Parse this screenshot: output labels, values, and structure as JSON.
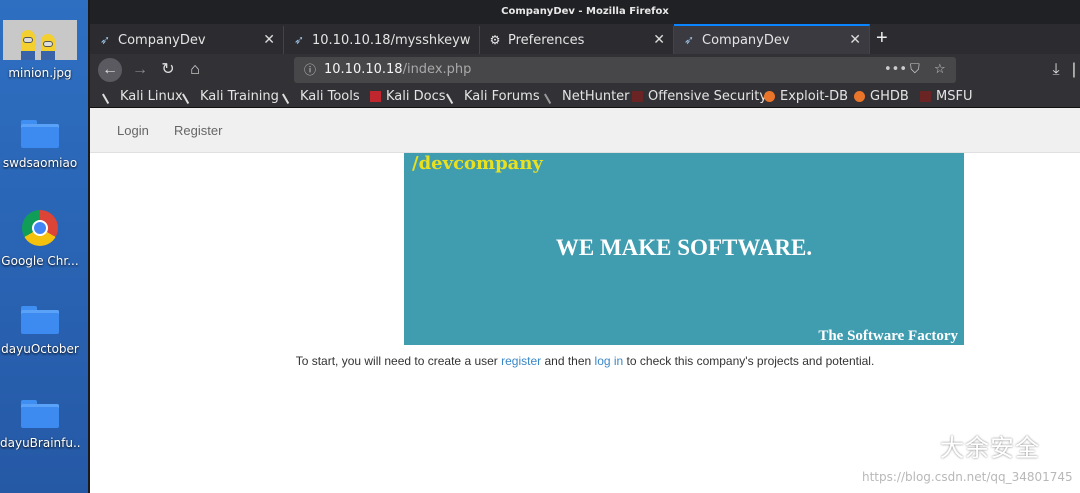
{
  "desktop": {
    "items": [
      {
        "label": "minion.jpg"
      },
      {
        "label": "swdsaomiao"
      },
      {
        "label": "Google Chr..."
      },
      {
        "label": "dayuOctober"
      },
      {
        "label": "dayuBrainfu..."
      }
    ]
  },
  "window": {
    "title": "CompanyDev - Mozilla Firefox"
  },
  "tabs": [
    {
      "label": "CompanyDev",
      "active": false
    },
    {
      "label": "10.10.10.18/mysshkeyw",
      "active": false
    },
    {
      "label": "Preferences",
      "active": false
    },
    {
      "label": "CompanyDev",
      "active": true
    }
  ],
  "urlbar": {
    "host": "10.10.10.18",
    "path": "/index.php"
  },
  "bookmarks": [
    {
      "label": "Kali Linux"
    },
    {
      "label": "Kali Training"
    },
    {
      "label": "Kali Tools"
    },
    {
      "label": "Kali Docs"
    },
    {
      "label": "Kali Forums"
    },
    {
      "label": "NetHunter"
    },
    {
      "label": "Offensive Security"
    },
    {
      "label": "Exploit-DB"
    },
    {
      "label": "GHDB"
    },
    {
      "label": "MSFU"
    }
  ],
  "site": {
    "nav": {
      "login": "Login",
      "register": "Register"
    },
    "banner": {
      "brand": "/devcompany",
      "headline": "WE MAKE SOFTWARE.",
      "tagline": "The Software Factory"
    },
    "intro": {
      "part1": "To start, you will need to create a user ",
      "link1": "register",
      "part2": " and then ",
      "link2": "log in",
      "part3": " to check this company's projects and potential."
    }
  },
  "watermark": {
    "title": "大余安全",
    "url": "https://blog.csdn.net/qq_34801745"
  },
  "colors": {
    "banner": "#409caf",
    "brand": "#e9e020",
    "link": "#3a87c8",
    "tab_accent": "#0a84ff"
  }
}
